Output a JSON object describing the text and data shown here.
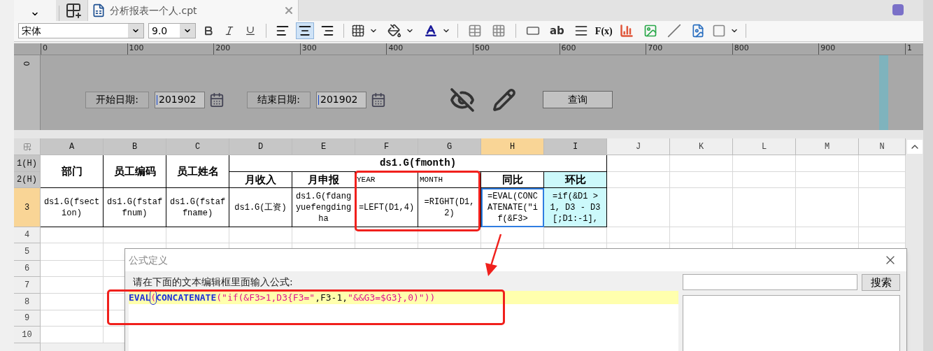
{
  "tab": {
    "title": "分析报表一个人.cpt"
  },
  "toolbar": {
    "font": "宋体",
    "size": "9.0",
    "align": [
      {
        "kind": "left",
        "selected": false
      },
      {
        "kind": "center",
        "selected": true
      },
      {
        "kind": "right",
        "selected": false
      }
    ],
    "text_tool": "ab",
    "formula_tool": "F(x)"
  },
  "ruler": {
    "labels": [
      "0",
      "100",
      "200",
      "300",
      "400",
      "500",
      "600",
      "700",
      "800",
      "900",
      "1"
    ],
    "vertical_label": "0"
  },
  "parameters": {
    "start_label": "开始日期:",
    "start_value": "201902",
    "end_label": "结束日期:",
    "end_value": "201902",
    "query_button": "查询"
  },
  "sheet": {
    "columns": [
      {
        "label": "A",
        "used": true,
        "selected": false
      },
      {
        "label": "B",
        "used": true,
        "selected": false
      },
      {
        "label": "C",
        "used": true,
        "selected": false
      },
      {
        "label": "D",
        "used": true,
        "selected": false
      },
      {
        "label": "E",
        "used": true,
        "selected": false
      },
      {
        "label": "F",
        "used": true,
        "selected": false
      },
      {
        "label": "G",
        "used": true,
        "selected": false
      },
      {
        "label": "H",
        "used": true,
        "selected": true
      },
      {
        "label": "I",
        "used": true,
        "selected": false
      },
      {
        "label": "J",
        "used": false,
        "selected": false
      },
      {
        "label": "K",
        "used": false,
        "selected": false
      },
      {
        "label": "L",
        "used": false,
        "selected": false
      },
      {
        "label": "M",
        "used": false,
        "selected": false
      },
      {
        "label": "N",
        "used": false,
        "selected": false
      }
    ],
    "rows": [
      {
        "label": "1(H)",
        "used": true,
        "selected": false
      },
      {
        "label": "2(H)",
        "used": true,
        "selected": false
      },
      {
        "label": "3",
        "used": true,
        "selected": true
      },
      {
        "label": "4",
        "used": false,
        "selected": false
      },
      {
        "label": "5",
        "used": false,
        "selected": false
      },
      {
        "label": "6",
        "used": false,
        "selected": false
      },
      {
        "label": "7",
        "used": false,
        "selected": false
      },
      {
        "label": "8",
        "used": false,
        "selected": false
      },
      {
        "label": "9",
        "used": false,
        "selected": false
      },
      {
        "label": "10",
        "used": false,
        "selected": false
      }
    ],
    "merged_headers": [
      "部门",
      "员工编码",
      "员工姓名"
    ],
    "group_title": "ds1.G(fmonth)",
    "row_2": [
      {
        "text": "月收入",
        "kind": "header",
        "highlight": false
      },
      {
        "text": "月申报",
        "kind": "header",
        "highlight": false
      },
      {
        "text": "YEAR",
        "kind": "plain",
        "highlight": false
      },
      {
        "text": "MONTH",
        "kind": "plain",
        "highlight": false
      },
      {
        "text": "同比",
        "kind": "header",
        "highlight": false
      },
      {
        "text": "环比",
        "kind": "header",
        "highlight": true
      }
    ],
    "row_3": [
      {
        "text": "ds1.G(fsection)",
        "selected": false,
        "highlight": false
      },
      {
        "text": "ds1.G(fstaffnum)",
        "selected": false,
        "highlight": false
      },
      {
        "text": "ds1.G(fstaffname)",
        "selected": false,
        "highlight": false
      },
      {
        "text": "ds1.G(工资)",
        "selected": false,
        "highlight": false
      },
      {
        "text": "ds1.G(fdangyuefengdingha",
        "selected": false,
        "highlight": false
      },
      {
        "text": "=LEFT(D1,4)",
        "selected": false,
        "highlight": false
      },
      {
        "text": "=RIGHT(D1,2)",
        "selected": false,
        "highlight": false
      },
      {
        "text": "=EVAL(CONCATENATE(\"if(&F3>",
        "selected": true,
        "highlight": false
      },
      {
        "text": "=if(&D1 > 1, D3 - D3[;D1:-1],",
        "selected": false,
        "highlight": true
      }
    ]
  },
  "dialog": {
    "title": "公式定义",
    "prompt": "请在下面的文本编辑框里面输入公式:",
    "search_button": "搜索",
    "formula": [
      {
        "text": "EVAL",
        "kind": "function"
      },
      {
        "text": "(",
        "kind": "cursor"
      },
      {
        "text": "CONCATENATE",
        "kind": "function"
      },
      {
        "text": "(\"if(&F3>1,D3{F3=\"",
        "kind": "string"
      },
      {
        "text": ",F3-1,",
        "kind": "plain"
      },
      {
        "text": "\"&&G3=$G3},0)\"))",
        "kind": "string"
      }
    ]
  }
}
